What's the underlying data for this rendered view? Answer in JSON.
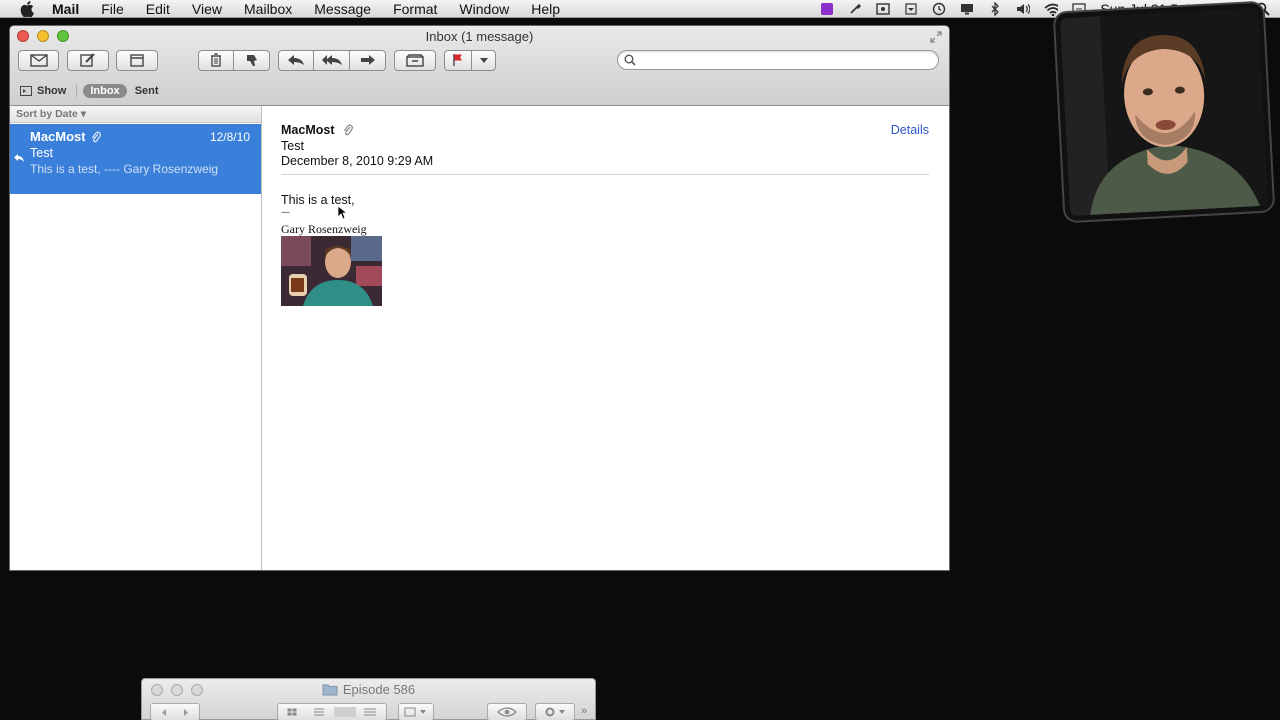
{
  "menubar": {
    "app_name": "Mail",
    "items": [
      "File",
      "Edit",
      "View",
      "Mailbox",
      "Message",
      "Format",
      "Window",
      "Help"
    ],
    "clock": "Sun Jul 31  5:47:21 PM"
  },
  "window": {
    "title": "Inbox (1 message)",
    "search": {
      "placeholder": "",
      "value": ""
    }
  },
  "favorites": {
    "show_label": "Show",
    "inbox_label": "Inbox",
    "sent_label": "Sent"
  },
  "message_list": {
    "sort_label": "Sort by Date ▾",
    "selected": {
      "sender": "MacMost",
      "date": "12/8/10",
      "subject": "Test",
      "preview": "This is a test, ---- Gary Rosenzweig"
    }
  },
  "viewer": {
    "from": "MacMost",
    "subject": "Test",
    "date": "December 8, 2010 9:29 AM",
    "details_label": "Details",
    "body": "This is a test,",
    "signature_separator": "----",
    "signature_name": "Gary Rosenzweig"
  },
  "finder": {
    "title": "Episode 586"
  },
  "colors": {
    "selection": "#3a7fd9",
    "link": "#2b55c9"
  }
}
